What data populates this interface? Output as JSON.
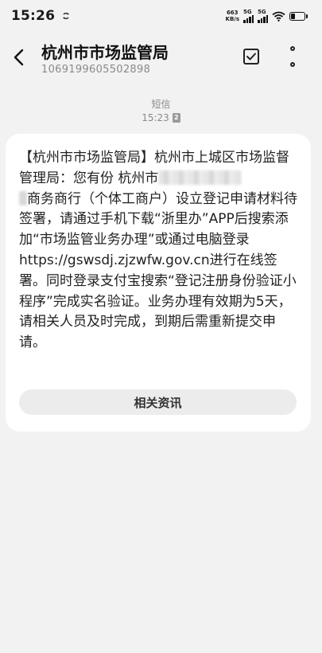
{
  "status_bar": {
    "time": "15:26",
    "net_speed_value": "663",
    "net_speed_unit": "KB/s",
    "sim1_label": "5G",
    "sim2_label": "5G",
    "battery_level": 0.3
  },
  "header": {
    "title": "杭州市市场监管局",
    "subtitle": "1069199605502898"
  },
  "meta": {
    "type": "短信",
    "time": "15:23",
    "sim_badge": "2"
  },
  "message": {
    "part1": "【杭州市市场监管局】杭州市上城区市场监督管理局：您有份 杭州市",
    "part2": "商务商行（个体工商户）设立登记申请材料待签署，请通过手机下载“浙里办”APP后搜索添加“市场监管业务办理”或通过电脑登录",
    "link": "https://gswsdj.zjzwfw.gov.cn",
    "part3": "进行在线签署。同时登录支付宝搜索“登记注册身份验证小程序”完成实名验证。业务办理有效期为5天，请相关人员及时完成，到期后需重新提交申请。"
  },
  "related_button": "相关资讯",
  "icons": {
    "back": "back-arrow-icon",
    "check": "checkbox-icon",
    "more": "more-vertical-icon",
    "sync": "sync-icon",
    "wifi": "wifi-icon",
    "battery": "battery-icon"
  }
}
